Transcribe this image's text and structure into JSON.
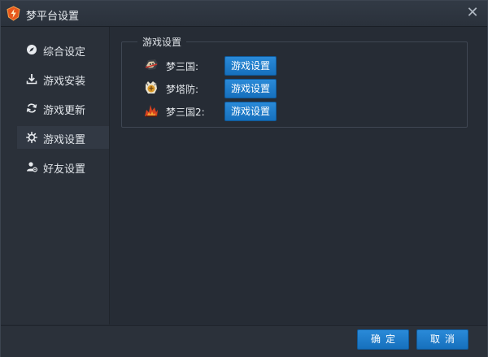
{
  "window": {
    "title": "梦平台设置",
    "close_glyph": "✕"
  },
  "sidebar": {
    "items": [
      {
        "label": "综合设定",
        "icon": "compass-icon"
      },
      {
        "label": "游戏安装",
        "icon": "download-icon"
      },
      {
        "label": "游戏更新",
        "icon": "refresh-icon"
      },
      {
        "label": "游戏设置",
        "icon": "gear-icon",
        "active": true
      },
      {
        "label": "好友设置",
        "icon": "friend-settings-icon"
      }
    ]
  },
  "main": {
    "group_title": "游戏设置",
    "games": [
      {
        "name": "梦三国:",
        "button": "游戏设置",
        "icon": "meng-sanguo-icon"
      },
      {
        "name": "梦塔防:",
        "button": "游戏设置",
        "icon": "meng-tafang-icon"
      },
      {
        "name": "梦三国2:",
        "button": "游戏设置",
        "icon": "meng-sanguo-2-icon"
      }
    ]
  },
  "footer": {
    "ok_label": "确定",
    "cancel_label": "取消"
  },
  "colors": {
    "accent": "#1a7ccd",
    "window_bg": "#262c35",
    "sidebar_bg": "#2a3039"
  }
}
